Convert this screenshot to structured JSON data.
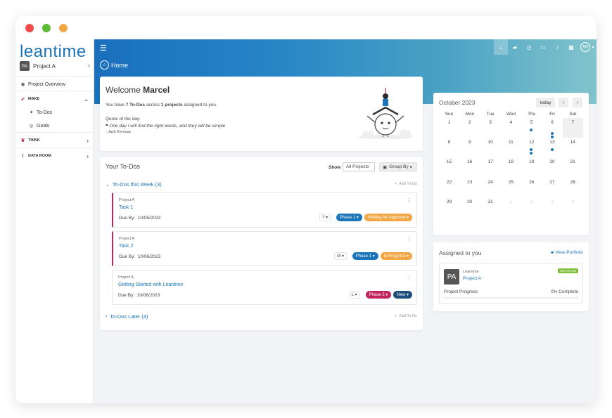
{
  "sidebar": {
    "logo": "leantime",
    "project": {
      "initials": "PA",
      "name": "Project A"
    },
    "items": [
      {
        "label": "Project Overview",
        "icon": "gauge-icon"
      },
      {
        "label": "MAKE",
        "icon": "rocket-icon"
      },
      {
        "label": "To-Dos",
        "icon": "pin-icon"
      },
      {
        "label": "Goals",
        "icon": "bullseye-icon"
      },
      {
        "label": "THINK",
        "icon": "brain-icon"
      },
      {
        "label": "DATA ROOM",
        "icon": "paperclip-icon"
      }
    ]
  },
  "header": {
    "breadcrumb": "Home",
    "user_initials": "MF"
  },
  "welcome": {
    "greeting": "Welcome",
    "name": "Marcel",
    "summary_pre": "You have",
    "todo_count": "7 To-Dos",
    "summary_mid": "across",
    "project_count": "1 projects",
    "summary_post": "assigned to you.",
    "quote_label": "Quote of the day:",
    "quote": "One day I will find the right words, and they will be simple",
    "author": "- Jack Kerouac"
  },
  "todos": {
    "title": "Your To-Dos",
    "show_label": "Show",
    "filter_value": "All Projects",
    "group_by_label": "Group By",
    "add_label": "Add To-Do",
    "group_this_week": "To-Dos this Week (3)",
    "group_later": "To-Dos Later (4)",
    "due_label": "Due By:",
    "tasks": [
      {
        "project": "Project A",
        "name": "Task 1",
        "due": "10/05/2023",
        "effort": "?",
        "phase": "Phase 1",
        "phase_color": "#1b75bb",
        "status": "Waiting for Approval",
        "status_color": "#f3a744"
      },
      {
        "project": "Project A",
        "name": "Task 2",
        "due": "10/06/2023",
        "effort": "M",
        "phase": "Phase 1",
        "phase_color": "#1b75bb",
        "status": "In Progress",
        "status_color": "#f3a744"
      },
      {
        "project": "Project A",
        "name": "Getting Started with Leantime",
        "due": "10/06/2023",
        "effort": "L",
        "phase": "Phase 2",
        "phase_color": "#c0245c",
        "status": "New",
        "status_color": "#1d4f7c"
      }
    ]
  },
  "calendar": {
    "month": "October 2023",
    "today_label": "today",
    "weekdays": [
      "Sun",
      "Mon",
      "Tue",
      "Wed",
      "Thu",
      "Fri",
      "Sat"
    ],
    "weeks": [
      [
        "1",
        "2",
        "3",
        "4",
        "5",
        "6",
        "7"
      ],
      [
        "8",
        "9",
        "10",
        "11",
        "12",
        "13",
        "14"
      ],
      [
        "15",
        "16",
        "17",
        "18",
        "19",
        "20",
        "21"
      ],
      [
        "22",
        "23",
        "24",
        "25",
        "26",
        "27",
        "28"
      ],
      [
        "29",
        "30",
        "31",
        "1",
        "2",
        "3",
        "4"
      ]
    ]
  },
  "assigned": {
    "title": "Assigned to you",
    "portfolio_link": "View Portfolio",
    "project": {
      "initials": "PA",
      "client": "Leantime",
      "name": "Project A",
      "status": "ON TRACK",
      "progress_label": "Project Progress",
      "progress_value": "0% Complete"
    }
  },
  "colors": {
    "accent": "#1b75bb",
    "brand_pink": "#c0245c",
    "warning": "#f3a744",
    "success": "#7fbf3d"
  }
}
